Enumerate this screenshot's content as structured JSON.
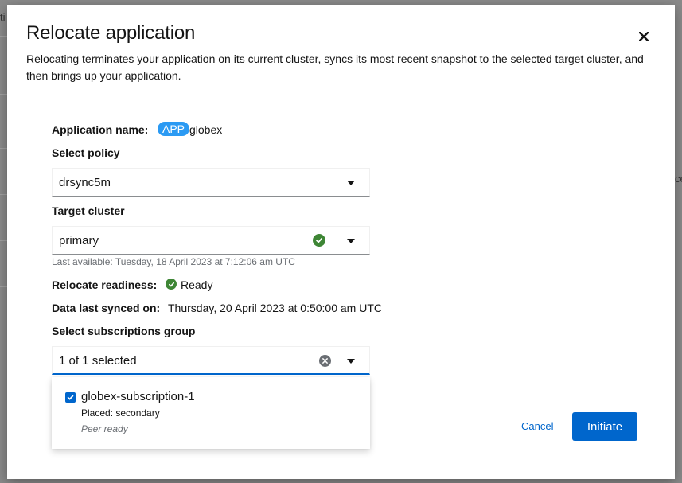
{
  "background": {
    "fragment_left": "ti",
    "fragment_right": "ce"
  },
  "modal": {
    "title": "Relocate application",
    "description": "Relocating terminates your application on its current cluster, syncs its most recent snapshot to the selected target cluster, and then brings up your application."
  },
  "app": {
    "label": "Application name:",
    "badge": "APP",
    "name": "globex"
  },
  "policy": {
    "label": "Select policy",
    "selected": "drsync5m"
  },
  "target": {
    "label": "Target cluster",
    "selected": "primary",
    "helper": "Last available: Tuesday, 18 April 2023 at 7:12:06 am UTC"
  },
  "readiness": {
    "label": "Relocate readiness:",
    "value": "Ready"
  },
  "sync": {
    "label": "Data last synced on:",
    "value": "Thursday, 20 April 2023 at 0:50:00 am UTC"
  },
  "subscriptions": {
    "label": "Select subscriptions group",
    "selected": "1 of 1 selected",
    "options": [
      {
        "title": "globex-subscription-1",
        "placed": "Placed: secondary",
        "status": "Peer ready",
        "checked": true
      }
    ]
  },
  "actions": {
    "cancel": "Cancel",
    "initiate": "Initiate"
  },
  "colors": {
    "primary": "#0066cc",
    "success": "#3e8635",
    "badge": "#2b9af3"
  }
}
